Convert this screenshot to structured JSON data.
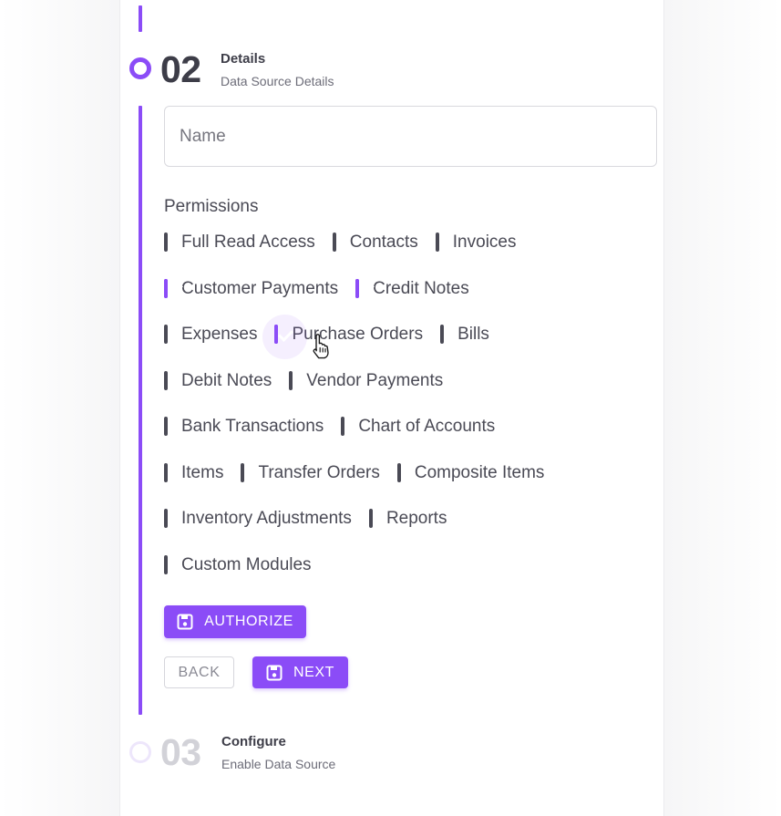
{
  "stepper": {
    "step2": {
      "number": "02",
      "title": "Details",
      "subtitle": "Data Source Details"
    },
    "step3": {
      "number": "03",
      "title": "Configure",
      "subtitle": "Enable Data Source"
    }
  },
  "name_field": {
    "placeholder": "Name",
    "value": ""
  },
  "permissions": {
    "label": "Permissions",
    "rows": [
      [
        {
          "label": "Full Read Access",
          "checked": false
        },
        {
          "label": "Contacts",
          "checked": false
        },
        {
          "label": "Invoices",
          "checked": false
        }
      ],
      [
        {
          "label": "Customer Payments",
          "checked": true
        },
        {
          "label": "Credit Notes",
          "checked": true
        }
      ],
      [
        {
          "label": "Expenses",
          "checked": false
        },
        {
          "label": "Purchase Orders",
          "checked": true
        },
        {
          "label": "Bills",
          "checked": false
        }
      ],
      [
        {
          "label": "Debit Notes",
          "checked": false
        },
        {
          "label": "Vendor Payments",
          "checked": false
        }
      ],
      [
        {
          "label": "Bank Transactions",
          "checked": false
        },
        {
          "label": "Chart of Accounts",
          "checked": false
        }
      ],
      [
        {
          "label": "Items",
          "checked": false
        },
        {
          "label": "Transfer Orders",
          "checked": false
        },
        {
          "label": "Composite Items",
          "checked": false
        }
      ],
      [
        {
          "label": "Inventory Adjustments",
          "checked": false
        },
        {
          "label": "Reports",
          "checked": false
        }
      ],
      [
        {
          "label": "Custom Modules",
          "checked": false
        }
      ]
    ]
  },
  "buttons": {
    "authorize": "AUTHORIZE",
    "back": "BACK",
    "next": "NEXT"
  },
  "icons": {
    "authorize_icon": "save-icon",
    "next_icon": "save-icon",
    "cursor": "hand-pointer-icon"
  },
  "colors": {
    "accent": "#8b4cf7",
    "text": "#4a4a55",
    "muted": "#d2d2d8"
  }
}
